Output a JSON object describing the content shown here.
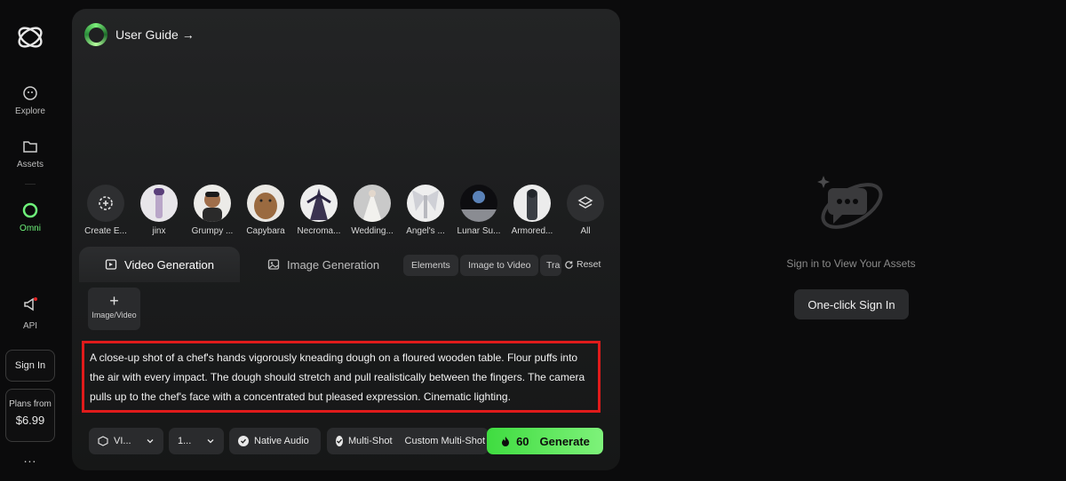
{
  "sidebar": {
    "nav": [
      {
        "label": "Explore",
        "icon": "explore-icon"
      },
      {
        "label": "Assets",
        "icon": "folder-icon"
      },
      {
        "label": "Omni",
        "icon": "omni-icon",
        "active": true
      },
      {
        "label": "API",
        "icon": "megaphone-icon"
      }
    ],
    "sign_in": "Sign In",
    "plans_label": "Plans from",
    "plans_price": "$6.99",
    "more": "..."
  },
  "guide": {
    "label": "User Guide →"
  },
  "characters": [
    {
      "label": "Create E...",
      "icon": "create-element-icon"
    },
    {
      "label": "jinx",
      "color": "#b9a6c8"
    },
    {
      "label": "Grumpy ...",
      "color": "#a06e4a"
    },
    {
      "label": "Capybara",
      "color": "#9a6a40"
    },
    {
      "label": "Necroma...",
      "color": "#3a3350"
    },
    {
      "label": "Wedding...",
      "color": "#d8d6d2"
    },
    {
      "label": "Angel's ...",
      "color": "#cfd0d6"
    },
    {
      "label": "Lunar Su...",
      "color": "#8a8c92"
    },
    {
      "label": "Armored...",
      "color": "#3a3e44"
    },
    {
      "label": "All",
      "icon": "layers-icon"
    }
  ],
  "tabs": {
    "video": "Video Generation",
    "image": "Image Generation"
  },
  "chips": [
    "Elements",
    "Image to Video",
    "Tra"
  ],
  "reset": "Reset",
  "upload": {
    "label": "Image/Video"
  },
  "prompt": "A close-up shot of a chef's hands vigorously kneading dough on a floured wooden table. Flour puffs into the air with every impact. The dough should stretch and pull realistically between the fingers. The camera pulls up to the chef's face with a concentrated but pleased expression. Cinematic lighting.",
  "controls": {
    "model": "VI...",
    "ratio": "1...",
    "native_audio": "Native Audio",
    "multi_shot": "Multi-Shot",
    "custom_multi_shot": "Custom Multi-Shot",
    "credits": "60",
    "generate": "Generate"
  },
  "assets": {
    "message": "Sign in to View Your Assets",
    "sign_in": "One-click Sign In"
  },
  "colors": {
    "accent": "#4ee04f",
    "highlight": "#e01b1b"
  }
}
